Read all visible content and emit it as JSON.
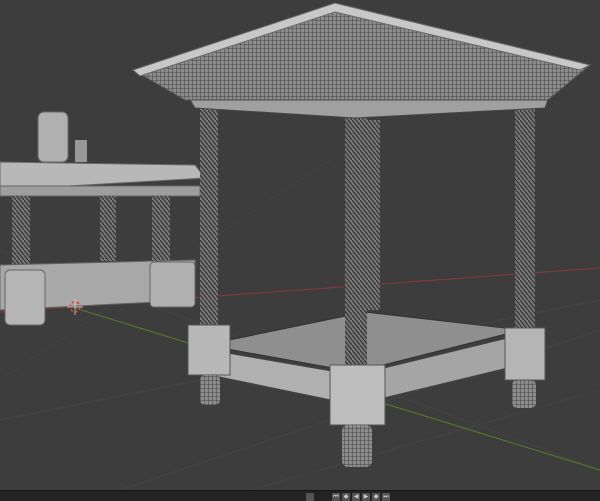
{
  "app": {
    "view": "3D Viewport"
  },
  "timeline": {
    "buttons": [
      "jump-start",
      "previous-keyframe",
      "play-reverse",
      "play",
      "next-keyframe",
      "jump-end"
    ]
  },
  "colors": {
    "background": "#3d3d3d",
    "x_axis": "#8a3a3a",
    "y_axis": "#5a7a2a",
    "mesh": "#9a9a9a",
    "wire": "#2a2a2a"
  }
}
